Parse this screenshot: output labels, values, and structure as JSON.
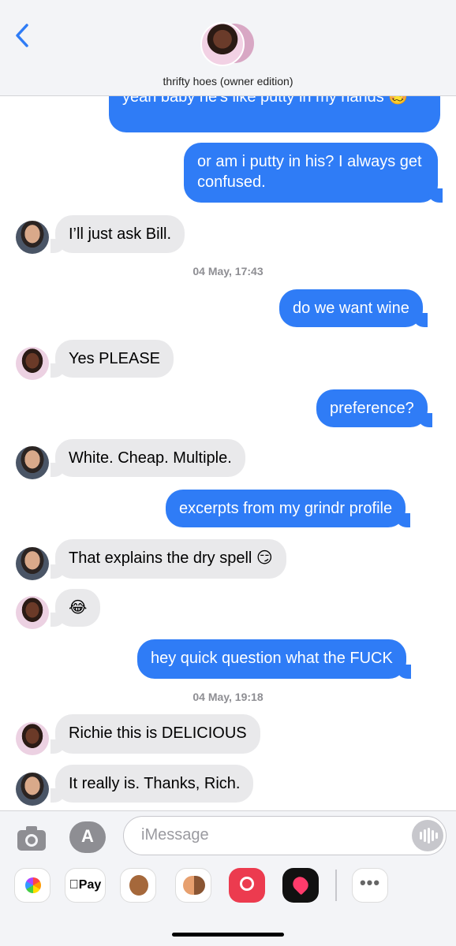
{
  "header": {
    "title": "thrifty hoes (owner edition)"
  },
  "messages": [
    {
      "id": "m0",
      "text": "yeah baby he's like putty in my hands 🥴"
    },
    {
      "id": "m1",
      "text": "or am i putty in his? I always get confused."
    },
    {
      "id": "m2",
      "text": "I’ll just ask Bill."
    },
    {
      "id": "m3",
      "text": "do we want wine"
    },
    {
      "id": "m4",
      "text": "Yes PLEASE"
    },
    {
      "id": "m5",
      "text": "preference?"
    },
    {
      "id": "m6",
      "text": "White. Cheap. Multiple."
    },
    {
      "id": "m7",
      "text": "excerpts from my grindr profile"
    },
    {
      "id": "m8",
      "text": "That explains the dry spell 😏"
    },
    {
      "id": "m9",
      "text": "😂"
    },
    {
      "id": "m10",
      "text": "hey quick question what the FUCK"
    },
    {
      "id": "m11",
      "text": "Richie this is DELICIOUS"
    },
    {
      "id": "m12",
      "text": "It really is. Thanks, Rich."
    }
  ],
  "timestamps": [
    "04 May, 17:43",
    "04 May, 19:18"
  ],
  "input": {
    "placeholder": "iMessage"
  },
  "app_drawer": {
    "pay_label": "Pay",
    "more_label": "•••"
  },
  "colors": {
    "outgoing": "#2f7cf6",
    "incoming": "#e9e9eb",
    "accent": "#2f7cf6"
  }
}
